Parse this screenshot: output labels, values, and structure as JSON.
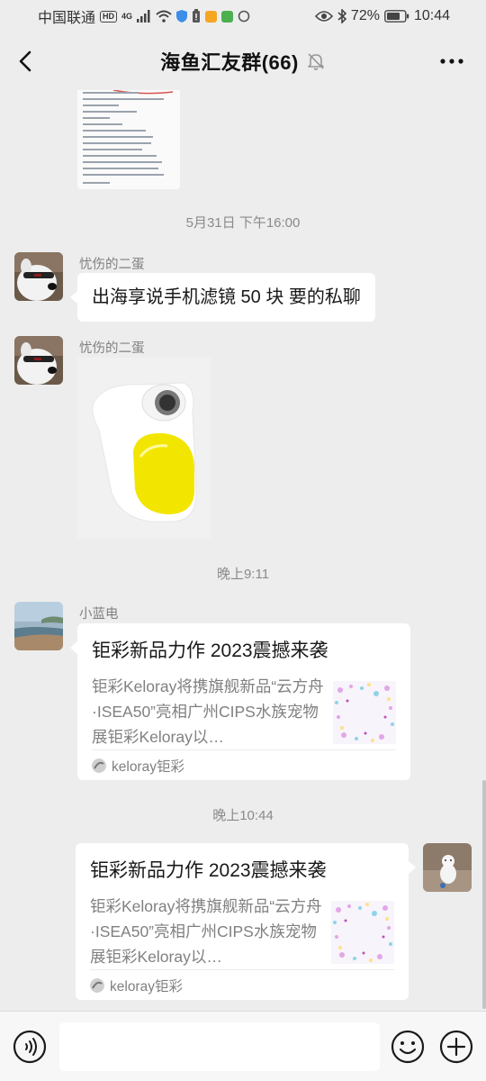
{
  "status_bar": {
    "carrier": "中国联通",
    "hd": "HD",
    "net": "4G",
    "battery": "72%",
    "time": "10:44"
  },
  "header": {
    "title": "海鱼汇友群(66)"
  },
  "messages": {
    "ts1": "5月31日 下午16:00",
    "msg1_sender": "忧伤的二蛋",
    "msg1_text": "出海享说手机滤镜 50 块 要的私聊",
    "msg2_sender": "忧伤的二蛋",
    "ts2": "晚上9:11",
    "msg3_sender": "小蓝电",
    "card1_title": "钜彩新品力作 2023震撼来袭",
    "card1_desc": "钜彩Keloray将携旗舰新品“云方舟·ISEA50”亮相广州CIPS水族宠物展钜彩Keloray以…",
    "card1_source": "keloray钜彩",
    "ts3": "晚上10:44",
    "card2_title": "钜彩新品力作 2023震撼来袭",
    "card2_desc": "钜彩Keloray将携旗舰新品“云方舟·ISEA50”亮相广州CIPS水族宠物展钜彩Keloray以…",
    "card2_source": "keloray钜彩"
  },
  "colors": {
    "background": "#ededed",
    "bubble": "#ffffff",
    "timestamp": "#8a8a8a",
    "accent_yellow": "#f2e600"
  },
  "icons": [
    "back-icon",
    "mute-bell-icon",
    "more-icon",
    "voice-icon",
    "emoji-icon",
    "plus-icon"
  ]
}
